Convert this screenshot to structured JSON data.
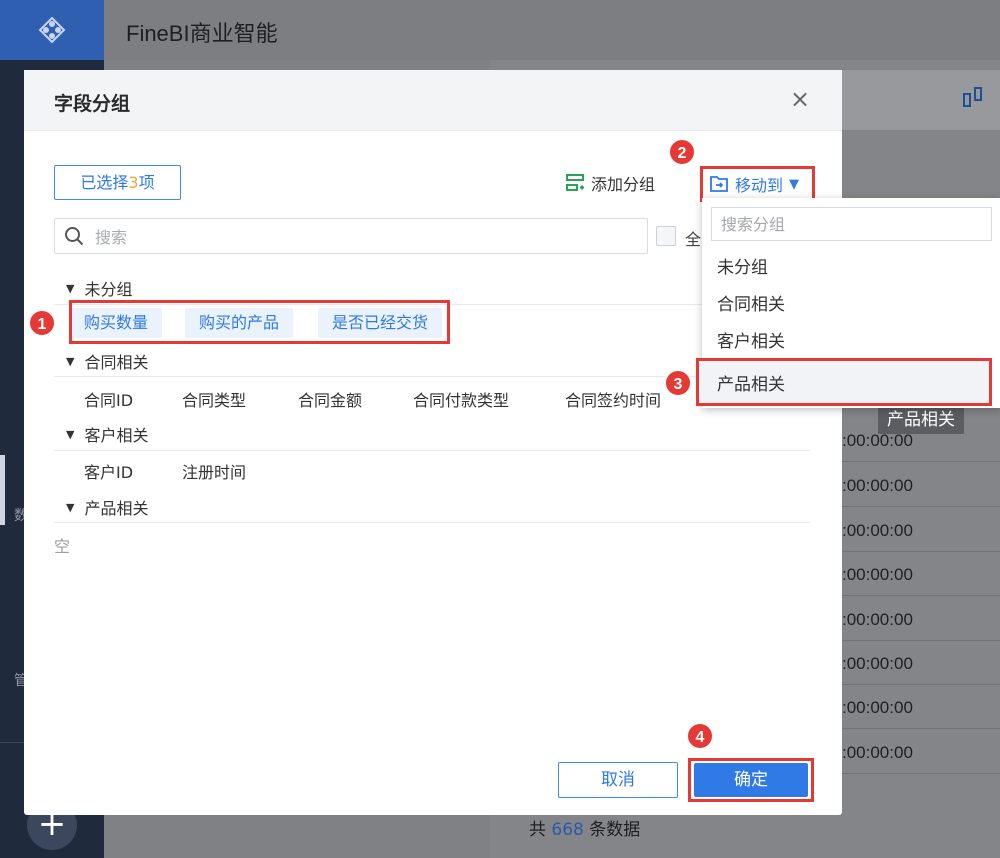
{
  "app": {
    "title": "FineBI商业智能"
  },
  "sidebar": {
    "plus": "+",
    "strip_labels": [
      "数",
      "管"
    ]
  },
  "background_table": {
    "tag": "产品相关",
    "time_values": [
      ":00:00:00",
      ":00:00:00",
      ":00:00:00",
      ":00:00:00",
      ":00:00:00",
      ":00:00:00",
      ":00:00:00",
      ":00:00:00"
    ],
    "footer": {
      "prefix": "共",
      "count": "668",
      "suffix": "条数据"
    }
  },
  "dialog": {
    "title": "字段分组",
    "close": "×",
    "selected": {
      "prefix": "已选择",
      "count": "3",
      "suffix": "项"
    },
    "add_group": "添加分组",
    "move_to": "移动到",
    "search_placeholder": "搜索",
    "select_all": "全",
    "groups": [
      {
        "name": "未分组",
        "fields": [
          "购买数量",
          "购买的产品",
          "是否已经交货"
        ]
      },
      {
        "name": "合同相关",
        "fields": [
          "合同ID",
          "合同类型",
          "合同金额",
          "合同付款类型",
          "合同签约时间"
        ]
      },
      {
        "name": "客户相关",
        "fields": [
          "客户ID",
          "注册时间"
        ]
      },
      {
        "name": "产品相关",
        "fields": []
      }
    ],
    "empty_text": "空",
    "cancel": "取消",
    "confirm": "确定"
  },
  "dropdown": {
    "search_placeholder": "搜索分组",
    "items": [
      "未分组",
      "合同相关",
      "客户相关",
      "产品相关"
    ]
  },
  "step_badges": [
    "1",
    "2",
    "3",
    "4"
  ],
  "colors": {
    "accent": "#2f7ae5",
    "highlight": "#e53935",
    "badge_count": "#f1a43b"
  }
}
